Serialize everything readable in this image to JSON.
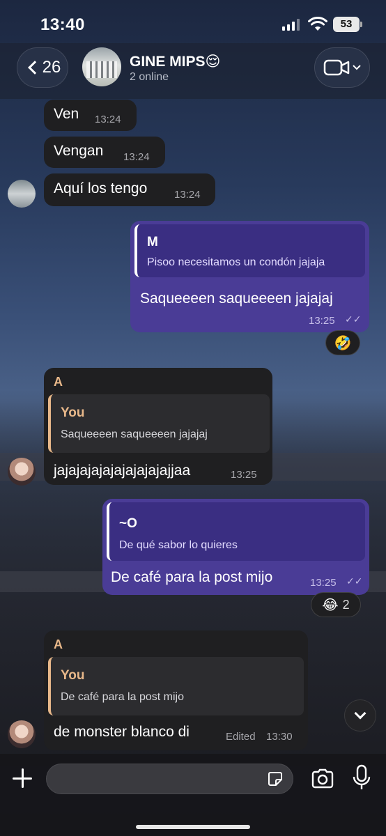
{
  "status_bar": {
    "time": "13:40",
    "battery": "53"
  },
  "header": {
    "back_count": "26",
    "title": "GINE MIPS😌",
    "subtitle": "2 online",
    "icons": {
      "back": "chevron-left-icon",
      "video": "video-camera-icon"
    }
  },
  "messages": [
    {
      "direction": "in",
      "text": "Ven",
      "time": "13:24"
    },
    {
      "direction": "in",
      "text": "Vengan",
      "time": "13:24"
    },
    {
      "direction": "in",
      "text": "Aquí los tengo",
      "time": "13:24"
    },
    {
      "direction": "out",
      "quote_name": "M",
      "quote_text": "Pisoo necesitamos un condón jajaja",
      "text": "Saqueeeen saqueeeen jajajaj",
      "time": "13:25",
      "reaction": "🤣"
    },
    {
      "direction": "in",
      "sender": "A",
      "quote_name": "You",
      "quote_text": "Saqueeeen saqueeeen jajajaj",
      "text": "jajajajajajajajajajajjaa",
      "time": "13:25"
    },
    {
      "direction": "out",
      "quote_name": "~O",
      "quote_text": "De qué sabor lo quieres",
      "text": "De café para la post mijo",
      "time": "13:25",
      "reaction": "😂",
      "reaction_count": "2"
    },
    {
      "direction": "in",
      "sender": "A",
      "quote_name": "You",
      "quote_text": "De café para la post mijo",
      "text": "de monster blanco di",
      "edited_label": "Edited",
      "time": "13:30"
    }
  ],
  "composer": {
    "placeholder": "",
    "icons": {
      "attach": "plus-icon",
      "sticker": "sticker-icon",
      "camera": "camera-icon",
      "mic": "microphone-icon"
    }
  },
  "colors": {
    "outgoing_bubble": "#4a3c96",
    "incoming_bubble": "#1f1f21",
    "sender_name": "#e8b88a"
  }
}
